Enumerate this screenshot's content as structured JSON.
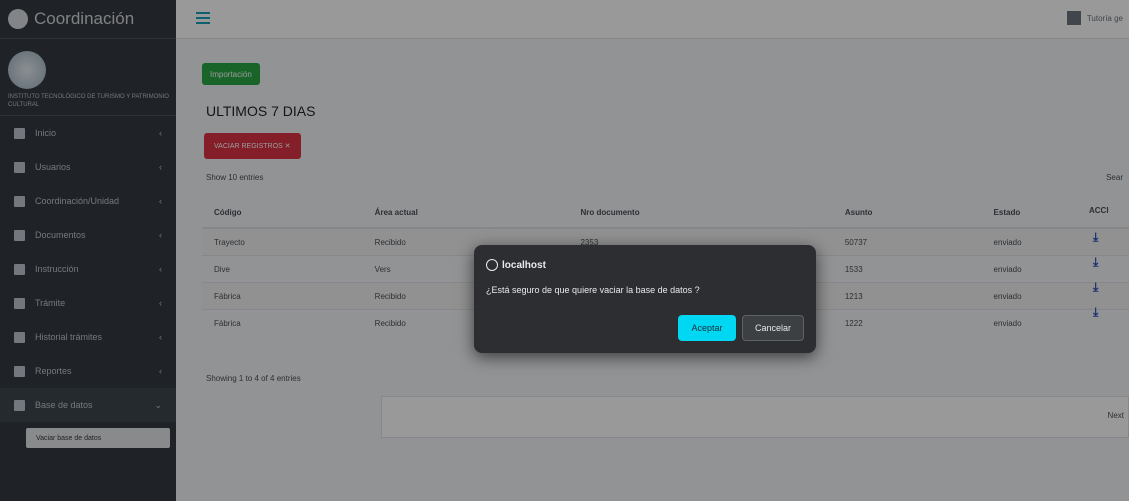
{
  "sidebar": {
    "brand": "Coordinación",
    "institution": "Instituto Tecnológico de Turismo y Patrimonio Cultural",
    "items": [
      {
        "label": "Inicio",
        "arrow": "‹"
      },
      {
        "label": "Usuarios",
        "arrow": "‹"
      },
      {
        "label": "Coordinación/Unidad",
        "arrow": "‹"
      },
      {
        "label": "Documentos",
        "arrow": "‹"
      },
      {
        "label": "Instrucción",
        "arrow": "‹"
      },
      {
        "label": "Trámite",
        "arrow": "‹"
      },
      {
        "label": "Historial trámites",
        "arrow": "‹"
      },
      {
        "label": "Reportes",
        "arrow": "‹"
      },
      {
        "label": "Base de datos",
        "arrow": "⌄"
      }
    ],
    "subitem": "Vaciar base de datos"
  },
  "topbar": {
    "user": "Tutoría ge"
  },
  "main": {
    "import_btn": "Importación",
    "title": "ULTIMOS 7 DIAS",
    "red_btn": "VACIAR REGISTROS ✕",
    "show_entries": "Show 10 entries",
    "search": "Sear",
    "columns": [
      "Código",
      "Área actual",
      "Nro documento",
      "Asunto",
      "Estado",
      "ACCI"
    ],
    "rows": [
      [
        "Trayecto",
        "Recibido",
        "2353",
        "50737",
        "enviado"
      ],
      [
        "Dive",
        "Vers",
        "",
        "1533",
        "enviado"
      ],
      [
        "Fábrica",
        "Recibido",
        "",
        "1213",
        "enviado"
      ],
      [
        "Fábrica",
        "Recibido",
        "",
        "1222",
        "enviado"
      ]
    ],
    "showing": "Showing 1 to 4 of 4 entries",
    "next": "Next"
  },
  "dialog": {
    "origin": "localhost",
    "message": "¿Está seguro de que quiere vaciar la base de datos ?",
    "ok": "Aceptar",
    "cancel": "Cancelar"
  },
  "colors": {
    "accent": "#00d7f2",
    "sidebar": "#343a40",
    "success": "#28a745",
    "danger": "#dc3545"
  }
}
